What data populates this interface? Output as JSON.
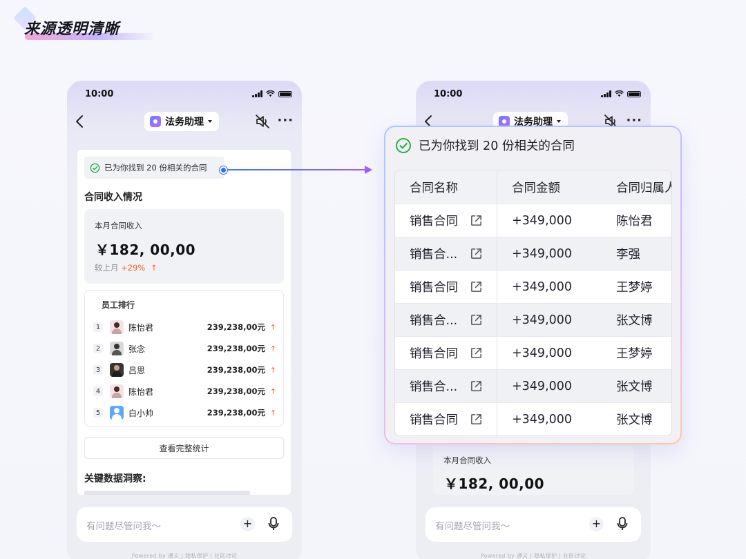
{
  "headline": "来源透明清晰",
  "phone": {
    "time": "10:00",
    "agent_name": "法务助理",
    "more": "···",
    "found_text": "已为你找到 20 份相关的合同",
    "section_title": "合同收入情况",
    "income_label": "本月合同收入",
    "income_amount": "￥182, 00,00",
    "compare_label": "较上月",
    "compare_value": "+29%",
    "compare_arrow": "↑",
    "ranking_title": "员工排行",
    "ranking": [
      {
        "no": "1",
        "name": "陈怡君",
        "value": "239,238,00元"
      },
      {
        "no": "2",
        "name": "张念",
        "value": "239,238,00元"
      },
      {
        "no": "3",
        "name": "吕思",
        "value": "239,238,00元"
      },
      {
        "no": "4",
        "name": "陈怡君",
        "value": "239,238,00元"
      },
      {
        "no": "5",
        "name": "白小帅",
        "value": "239,238,00元"
      }
    ],
    "up_arrow": "↑",
    "full_stats_button": "查看完整统计",
    "insight_title": "关键数据洞察:",
    "input_placeholder": "有问题尽管问我～",
    "plus": "+",
    "footer": "Powered by 通义   |   隐私保护   |   社区讨论"
  },
  "popup": {
    "found_text": "已为你找到 20 份相关的合同",
    "columns": [
      "合同名称",
      "合同金额",
      "合同归属人"
    ],
    "rows": [
      {
        "name": "销售合同",
        "amount": "+349,000",
        "owner": "陈怡君"
      },
      {
        "name": "销售合...",
        "amount": "+349,000",
        "owner": "李强"
      },
      {
        "name": "销售合同",
        "amount": "+349,000",
        "owner": "王梦婷"
      },
      {
        "name": "销售合...",
        "amount": "+349,000",
        "owner": "张文博"
      },
      {
        "name": "销售合同",
        "amount": "+349,000",
        "owner": "王梦婷"
      },
      {
        "name": "销售合...",
        "amount": "+349,000",
        "owner": "张文博"
      },
      {
        "name": "销售合同",
        "amount": "+349,000",
        "owner": "张文博"
      }
    ]
  },
  "colors": {
    "accent_up": "#ff5a1f",
    "check_green": "#22b34a",
    "connector": "#2f6bff"
  }
}
